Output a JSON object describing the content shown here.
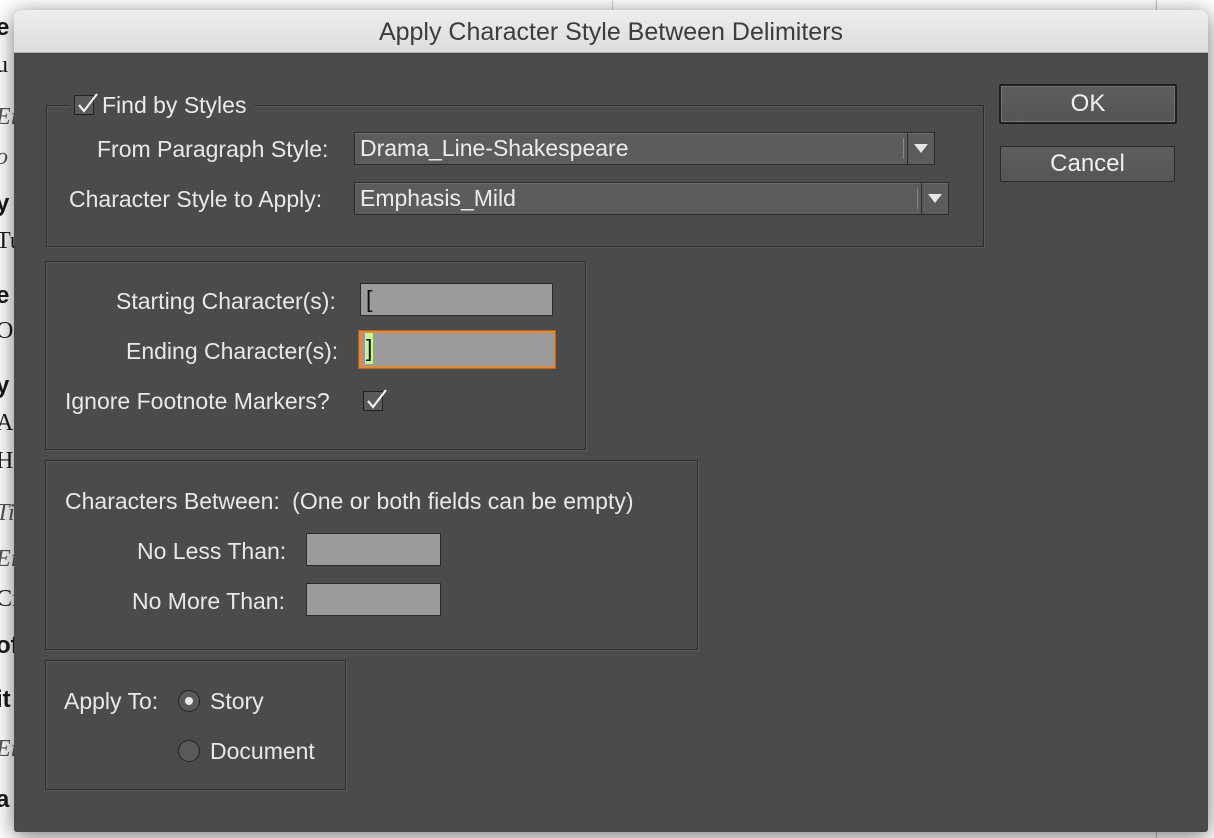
{
  "background": {
    "left_fragments": [
      "e",
      "u",
      "Ei",
      "o",
      "y",
      "Tu",
      "e",
      "Oi",
      "y",
      "As",
      "Ha",
      "Ti",
      "Ei",
      "Ci",
      "of",
      "it",
      "Ei",
      "a"
    ]
  },
  "dialog": {
    "title": "Apply Character Style Between Delimiters",
    "find_by_styles": {
      "label": "Find by Styles",
      "checked": true,
      "paragraph_style_label": "From Paragraph Style:",
      "paragraph_style_value": "Drama_Line-Shakespeare",
      "character_style_label": "Character Style to Apply:",
      "character_style_value": "Emphasis_Mild"
    },
    "delimiters": {
      "starting_label": "Starting Character(s):",
      "starting_value": "[",
      "ending_label": "Ending Character(s):",
      "ending_value": "]",
      "ignore_footnote_label": "Ignore Footnote Markers?",
      "ignore_footnote_checked": true
    },
    "characters_between": {
      "label": "Characters Between:",
      "note": "(One or both fields can be empty)",
      "no_less_than_label": "No Less Than:",
      "no_less_than_value": "",
      "no_more_than_label": "No More Than:",
      "no_more_than_value": ""
    },
    "apply_to": {
      "label": "Apply To:",
      "options": [
        "Story",
        "Document"
      ],
      "selected": "Story"
    },
    "buttons": {
      "ok": "OK",
      "cancel": "Cancel"
    }
  },
  "colors": {
    "dialog_bg": "#4b4b4b",
    "focus_ring": "#e0893a",
    "field_bg": "#9b9b9b"
  }
}
